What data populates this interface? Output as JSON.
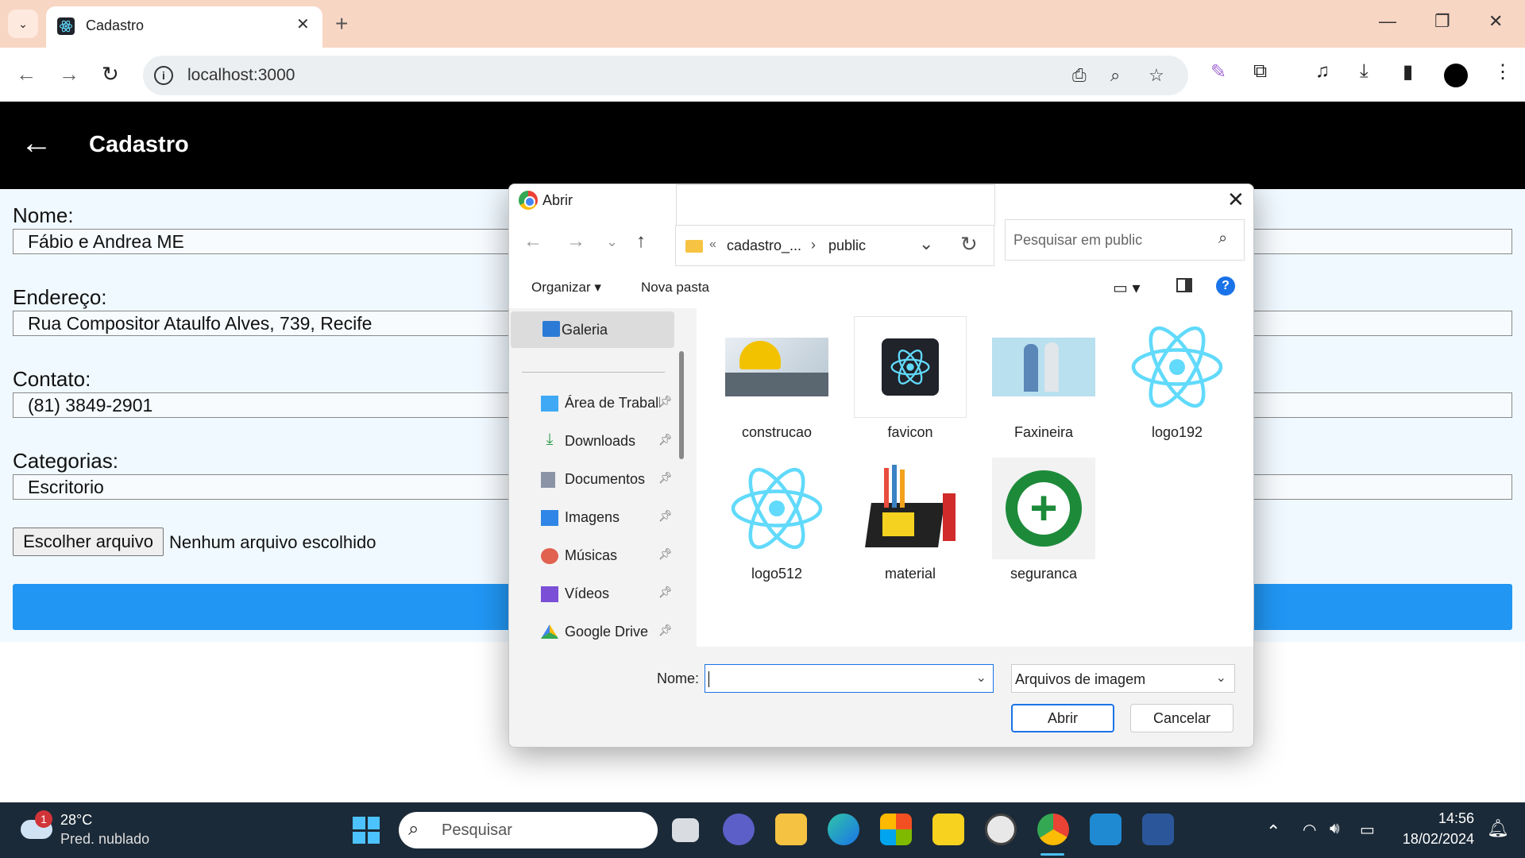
{
  "browser": {
    "tab_title": "Cadastro",
    "url": "localhost:3000",
    "newtab_label": "+"
  },
  "app": {
    "title": "Cadastro",
    "fields": [
      {
        "label": "Nome:",
        "value": "Fábio e Andrea ME"
      },
      {
        "label": "Endereço:",
        "value": "Rua Compositor Ataulfo Alves, 739, Recife"
      },
      {
        "label": "Contato:",
        "value": "(81) 3849-2901"
      },
      {
        "label": "Categorias:",
        "value": "Escritorio"
      }
    ],
    "file_button": "Escolher arquivo",
    "file_status": "Nenhum arquivo escolhido"
  },
  "dialog": {
    "title": "Abrir",
    "path_prefix": "«",
    "path_parent": "cadastro_...",
    "path_sep": "›",
    "path_current": "public",
    "search_placeholder": "Pesquisar em public",
    "organize": "Organizar ▾",
    "new_folder": "Nova pasta",
    "sidebar": {
      "galeria": "Galeria",
      "items": [
        "Área de Trabalho",
        "Downloads",
        "Documentos",
        "Imagens",
        "Músicas",
        "Vídeos",
        "Google Drive"
      ]
    },
    "files": [
      "construcao",
      "favicon",
      "Faxineira",
      "logo192",
      "logo512",
      "material",
      "seguranca"
    ],
    "name_label": "Nome:",
    "name_value": "",
    "filetype": "Arquivos de imagem",
    "open_button": "Abrir",
    "cancel_button": "Cancelar"
  },
  "taskbar": {
    "weather_badge": "1",
    "temperature": "28°C",
    "condition": "Pred. nublado",
    "search_placeholder": "Pesquisar",
    "time": "14:56",
    "date": "18/02/2024"
  },
  "colors": {
    "tabbar": "#f8d6c4",
    "app_header": "#000000",
    "submit": "#2196f3",
    "form_bg": "#f0f9ff",
    "react": "#61dafb"
  }
}
